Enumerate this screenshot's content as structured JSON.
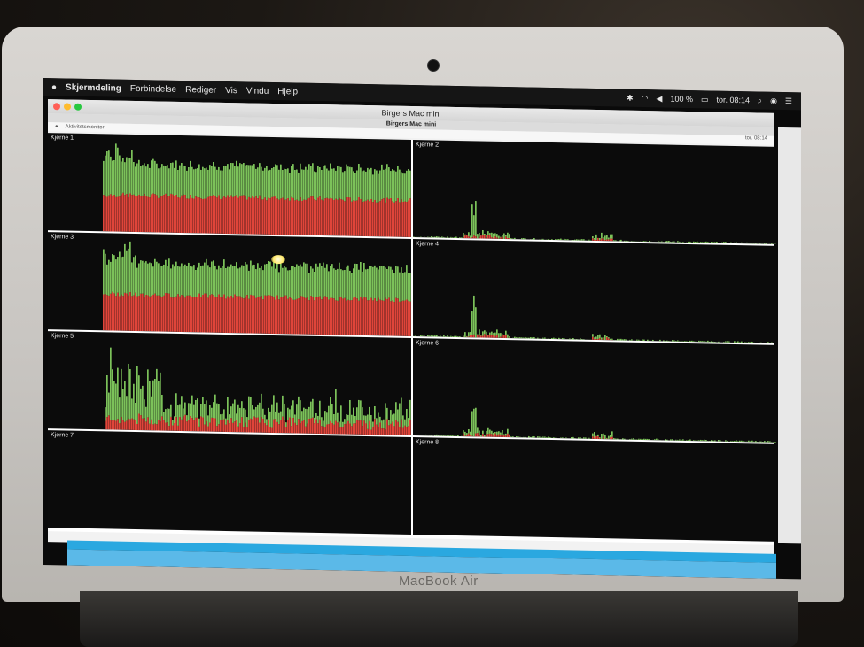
{
  "device": {
    "brand": "MacBook Air"
  },
  "menubar": {
    "apple": "",
    "app": "Skjermdeling",
    "items": [
      "Forbindelse",
      "Rediger",
      "Vis",
      "Vindu",
      "Hjelp"
    ],
    "battery": "100 %",
    "clock": "tor. 08:14"
  },
  "window": {
    "title": "Birgers Mac mini",
    "subtitle": "Birgers Mac mini"
  },
  "remote": {
    "app": "Aktivitetsmonitor",
    "clock": "tor. 08:14"
  },
  "colors": {
    "user": "#e0453a",
    "system": "#7cc25a",
    "bg": "#0b0b0b"
  },
  "cores": [
    {
      "name": "Kjerne 1",
      "profile": "high"
    },
    {
      "name": "Kjerne 2",
      "profile": "idle"
    },
    {
      "name": "Kjerne 3",
      "profile": "high"
    },
    {
      "name": "Kjerne 4",
      "profile": "idle"
    },
    {
      "name": "Kjerne 5",
      "profile": "medium"
    },
    {
      "name": "Kjerne 6",
      "profile": "idle"
    },
    {
      "name": "Kjerne 7",
      "profile": "empty"
    },
    {
      "name": "Kjerne 8",
      "profile": "empty"
    }
  ]
}
